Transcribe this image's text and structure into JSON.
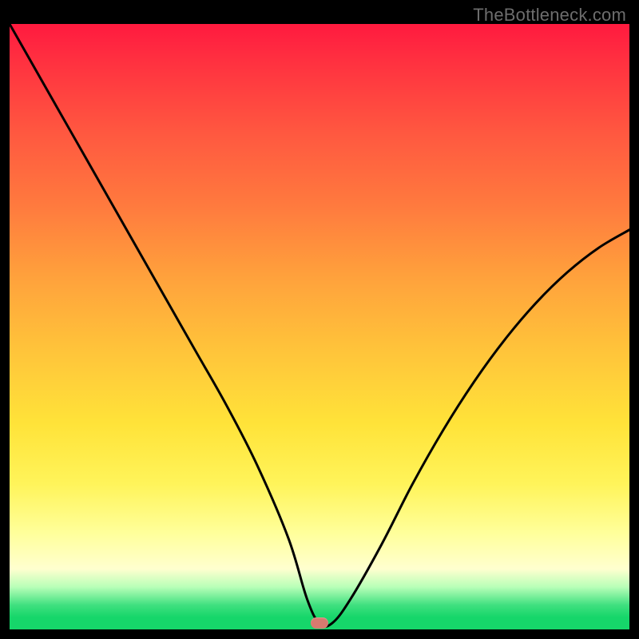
{
  "watermark": {
    "text": "TheBottleneck.com"
  },
  "chart_data": {
    "type": "line",
    "title": "",
    "xlabel": "",
    "ylabel": "",
    "xlim": [
      0,
      100
    ],
    "ylim": [
      0,
      100
    ],
    "series": [
      {
        "name": "bottleneck-curve",
        "x": [
          0,
          5,
          10,
          15,
          20,
          25,
          30,
          35,
          40,
          45,
          48,
          50,
          52,
          55,
          60,
          65,
          70,
          75,
          80,
          85,
          90,
          95,
          100
        ],
        "values": [
          100,
          91,
          82,
          73,
          64,
          55,
          46,
          37,
          27,
          15,
          5,
          1,
          1,
          5,
          14,
          24,
          33,
          41,
          48,
          54,
          59,
          63,
          66
        ]
      }
    ],
    "annotations": [
      {
        "name": "marker",
        "x": 50,
        "y": 1
      }
    ],
    "background_gradient": {
      "stops": [
        {
          "pos": 0,
          "color": "#ff1a3f"
        },
        {
          "pos": 50,
          "color": "#ffc43a"
        },
        {
          "pos": 85,
          "color": "#ffff9a"
        },
        {
          "pos": 100,
          "color": "#16d66a"
        }
      ]
    }
  }
}
